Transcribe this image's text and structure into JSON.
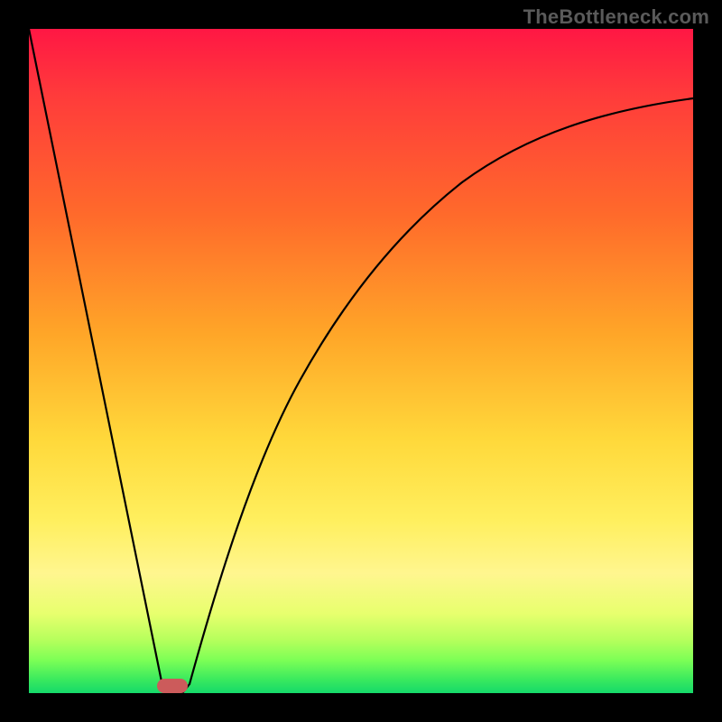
{
  "watermark": "TheBottleneck.com",
  "colors": {
    "frame": "#000000",
    "gradient_top": "#ff1744",
    "gradient_mid": "#ffd93b",
    "gradient_bottom": "#15d96a",
    "curve_stroke": "#000000",
    "marker": "#cc5b5b"
  },
  "chart_data": {
    "type": "line",
    "title": "",
    "xlabel": "",
    "ylabel": "",
    "xlim": [
      0,
      100
    ],
    "ylim": [
      0,
      100
    ],
    "grid": false,
    "legend": false,
    "description": "V-shaped bottleneck curve. Left branch is a steep straight descent from top-left down to a minimum near x≈21. Right branch is a concave-up curve rising from the minimum and saturating toward the top-right.",
    "series": [
      {
        "name": "left-branch",
        "x": [
          0,
          5,
          10,
          15,
          19.5,
          21
        ],
        "values": [
          100,
          76,
          52,
          28,
          6,
          0
        ]
      },
      {
        "name": "right-branch",
        "x": [
          23,
          26,
          30,
          35,
          40,
          45,
          50,
          55,
          60,
          65,
          70,
          75,
          80,
          85,
          90,
          95,
          100
        ],
        "values": [
          0,
          12,
          26,
          40,
          51,
          60,
          67,
          72,
          76,
          79,
          82,
          84,
          85.5,
          87,
          88,
          89,
          89.5
        ]
      }
    ],
    "marker": {
      "x_center": 21.5,
      "y": 0,
      "width_fraction": 0.046
    }
  }
}
